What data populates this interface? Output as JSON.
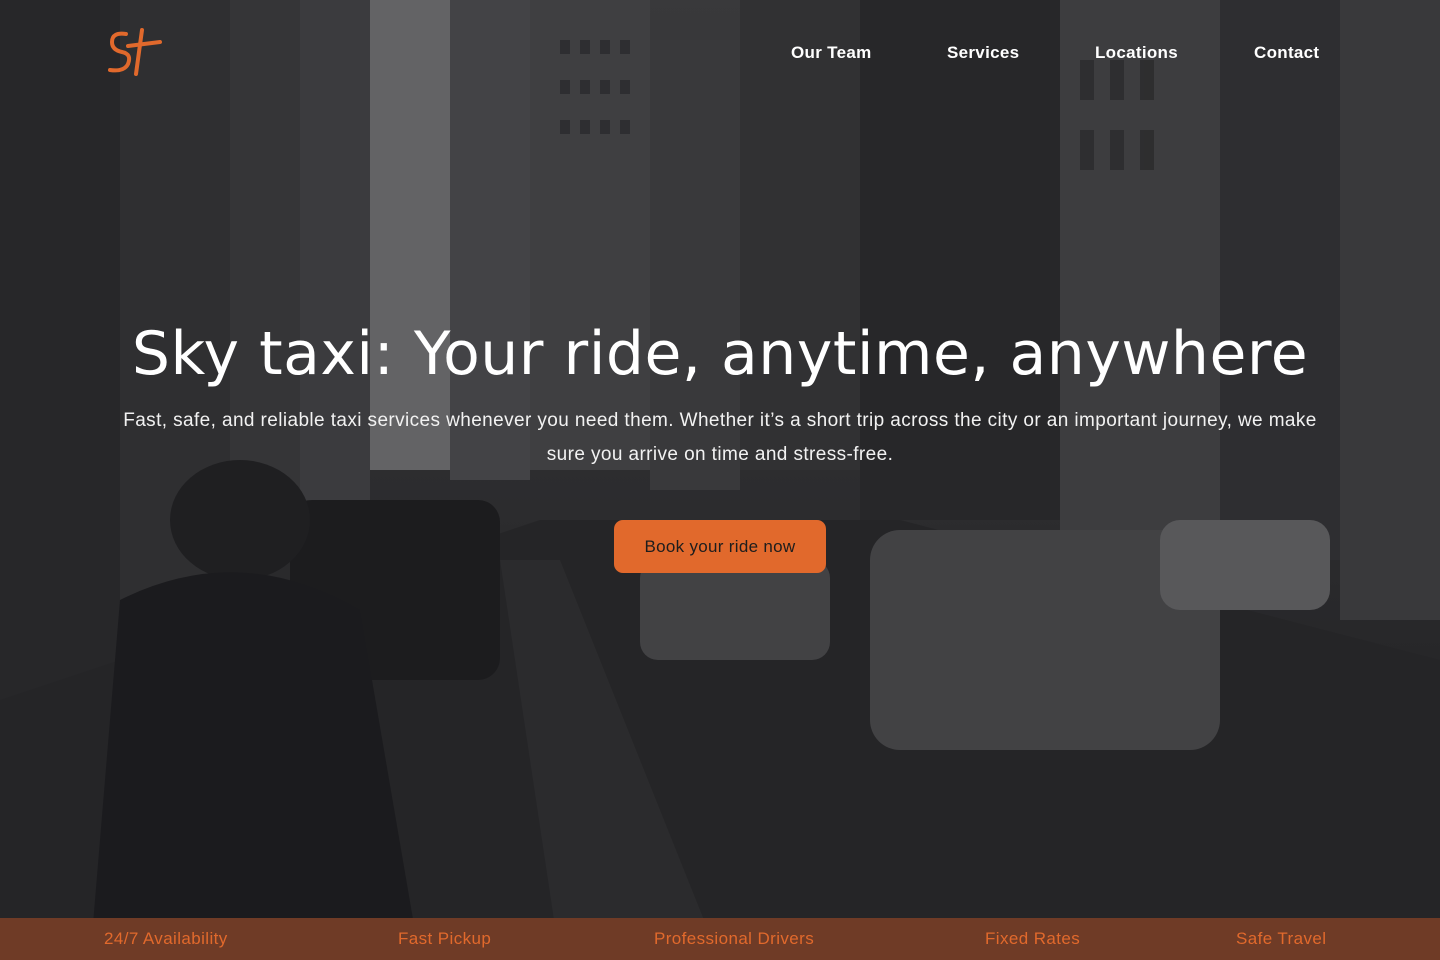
{
  "brand": {
    "logo_text": "St",
    "accent_color": "#e1692c"
  },
  "nav": {
    "items": [
      "Our Team",
      "Services",
      "Locations",
      "Contact"
    ]
  },
  "hero": {
    "title": "Sky taxi: Your ride, anytime, anywhere",
    "subtitle": "Fast, safe, and reliable taxi services whenever you need them. Whether it’s a short trip across the city or an important journey, we make sure you arrive on time and stress-free.",
    "cta_label": "Book your ride now",
    "background": "city-street-taxi-photo"
  },
  "features": {
    "background_color": "#6f3b26",
    "items": [
      "24/7 Availability",
      "Fast Pickup",
      "Professional Drivers",
      "Fixed Rates",
      "Safe Travel"
    ]
  }
}
